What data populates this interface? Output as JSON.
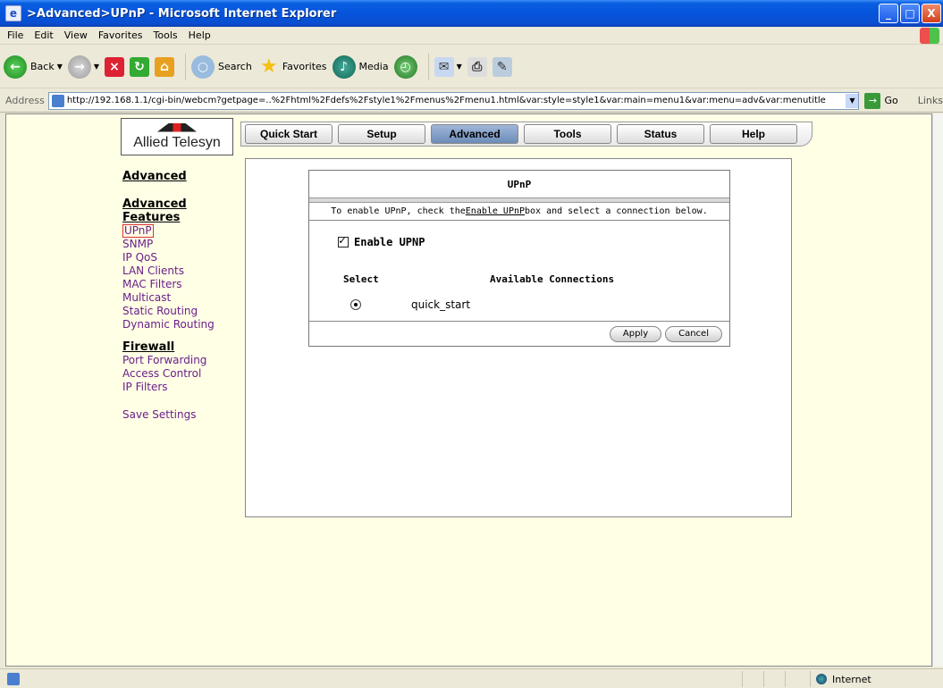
{
  "window": {
    "title": ">Advanced>UPnP - Microsoft Internet Explorer",
    "minimize": "_",
    "maximize": "□",
    "close": "X"
  },
  "menubar": [
    "File",
    "Edit",
    "View",
    "Favorites",
    "Tools",
    "Help"
  ],
  "toolbar": {
    "back": "Back",
    "search": "Search",
    "favorites": "Favorites",
    "media": "Media"
  },
  "address": {
    "label": "Address",
    "url": "http://192.168.1.1/cgi-bin/webcm?getpage=..%2Fhtml%2Fdefs%2Fstyle1%2Fmenus%2Fmenu1.html&var:style=style1&var:main=menu1&var:menu=adv&var:menutitle",
    "go": "Go",
    "links": "Links"
  },
  "logo": {
    "text": "Allied Telesyn"
  },
  "nav": {
    "tabs": [
      "Quick Start",
      "Setup",
      "Advanced",
      "Tools",
      "Status",
      "Help"
    ],
    "active": "Advanced"
  },
  "leftnav": {
    "heading": "Advanced",
    "features_heading": "Advanced Features",
    "features": [
      "UPnP",
      "SNMP",
      "IP QoS",
      "LAN Clients",
      "MAC Filters",
      "Multicast",
      "Static Routing",
      "Dynamic Routing"
    ],
    "firewall_heading": "Firewall",
    "firewall": [
      "Port Forwarding",
      "Access Control",
      "IP Filters"
    ],
    "save": "Save Settings"
  },
  "upnp": {
    "title": "UPnP",
    "instruction_pre": "To enable UPnP, check the ",
    "instruction_link": "Enable UPnP",
    "instruction_post": " box and select a connection below.",
    "enable_label": "Enable UPNP",
    "enable_checked": true,
    "col_select": "Select",
    "col_connections": "Available Connections",
    "connection": "quick_start",
    "apply": "Apply",
    "cancel": "Cancel"
  },
  "status": {
    "zone": "Internet"
  }
}
